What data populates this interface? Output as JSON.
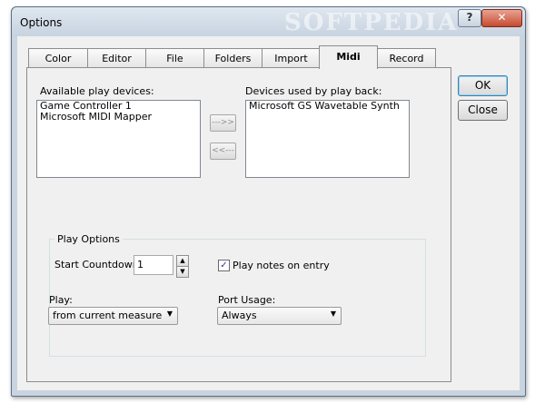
{
  "window": {
    "title": "Options",
    "watermark": "SOFTPEDIA",
    "help_glyph": "?",
    "close_glyph": "✕"
  },
  "tabs": [
    {
      "label": "Color"
    },
    {
      "label": "Editor"
    },
    {
      "label": "File"
    },
    {
      "label": "Folders"
    },
    {
      "label": "Import"
    },
    {
      "label": "Midi"
    },
    {
      "label": "Record"
    }
  ],
  "active_tab": "Midi",
  "available": {
    "label": "Available play devices:",
    "items": [
      "Game Controller 1",
      "Microsoft MIDI Mapper"
    ]
  },
  "used": {
    "label": "Devices used by play back:",
    "items": [
      "Microsoft GS Wavetable Synth"
    ]
  },
  "move_right_label": "--->>",
  "move_left_label": "<<---",
  "play_options": {
    "title": "Play Options",
    "countdown_label": "Start Countdown:",
    "countdown_value": "1",
    "play_notes_label": "Play notes on entry",
    "play_notes_checked": true,
    "play_label": "Play:",
    "play_value": "from current measure",
    "port_label": "Port Usage:",
    "port_value": "Always"
  },
  "buttons": {
    "ok": "OK",
    "close": "Close"
  },
  "icons": {
    "spin_up": "▲",
    "spin_down": "▼",
    "dropdown": "▼",
    "check": "✓"
  }
}
